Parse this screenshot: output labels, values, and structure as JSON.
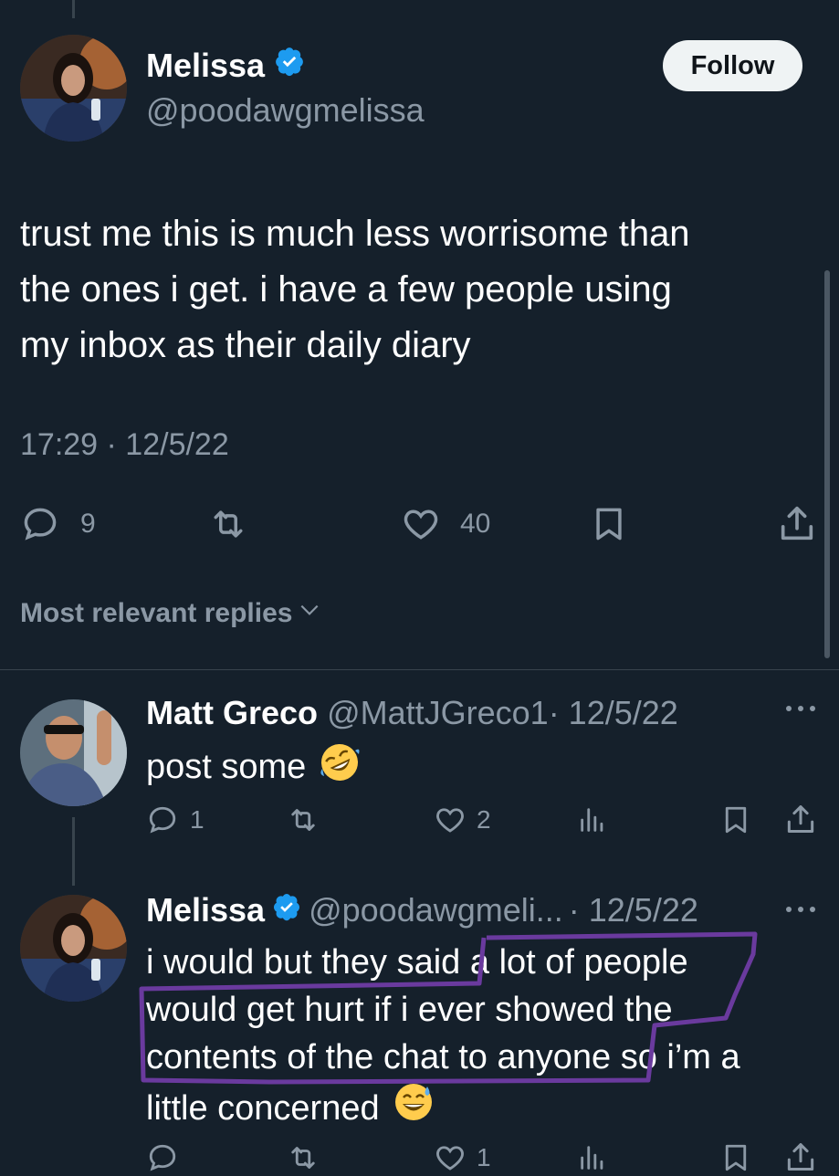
{
  "main_tweet": {
    "author_name": "Melissa",
    "author_handle": "@poodawgmelissa",
    "follow_label": "Follow",
    "text_lines": [
      "trust me this is much less worrisome than",
      "the ones i get. i have a few people using",
      "my inbox as their daily diary"
    ],
    "timestamp": "17:29 · 12/5/22",
    "reply_count": "9",
    "like_count": "40"
  },
  "replies_sort_label": "Most relevant replies",
  "reply1": {
    "author_name": "Matt Greco",
    "author_handle": "@MattJGreco1",
    "date": "· 12/5/22",
    "text": "post some",
    "emoji": "rolling-on-floor-laughing",
    "reply_count": "1",
    "like_count": "2"
  },
  "reply2": {
    "author_name": "Melissa",
    "author_handle": "@poodawgmeli...",
    "date": "· 12/5/22",
    "text_lines": [
      "i would but they said a lot of people",
      "would get hurt if i ever showed the",
      "contents of the chat to anyone so i’m a",
      "little concerned"
    ],
    "emoji": "grinning-sweat",
    "like_count": "1"
  },
  "colors": {
    "background": "#15202b",
    "muted": "#8b98a5",
    "verified": "#1d9bf0",
    "highlight": "#6a3a9e"
  },
  "icons": [
    "verified-badge-icon",
    "reply-icon",
    "retweet-icon",
    "like-icon",
    "bookmark-icon",
    "share-icon",
    "views-icon",
    "more-icon",
    "chevron-down-icon"
  ]
}
